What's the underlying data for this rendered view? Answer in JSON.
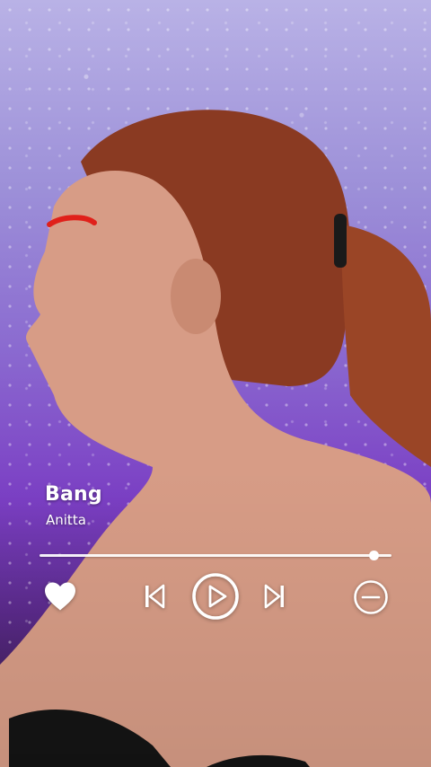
{
  "player": {
    "title": "Bang",
    "artist": "Anitta",
    "progress": 0.95
  },
  "controls": {
    "like_icon": "heart-icon",
    "previous_icon": "skip-previous-icon",
    "play_icon": "play-icon",
    "next_icon": "skip-next-icon",
    "remove_icon": "minus-circle-icon"
  },
  "colors": {
    "foreground": "#ffffff",
    "background_purple": "#7b3fc4"
  }
}
